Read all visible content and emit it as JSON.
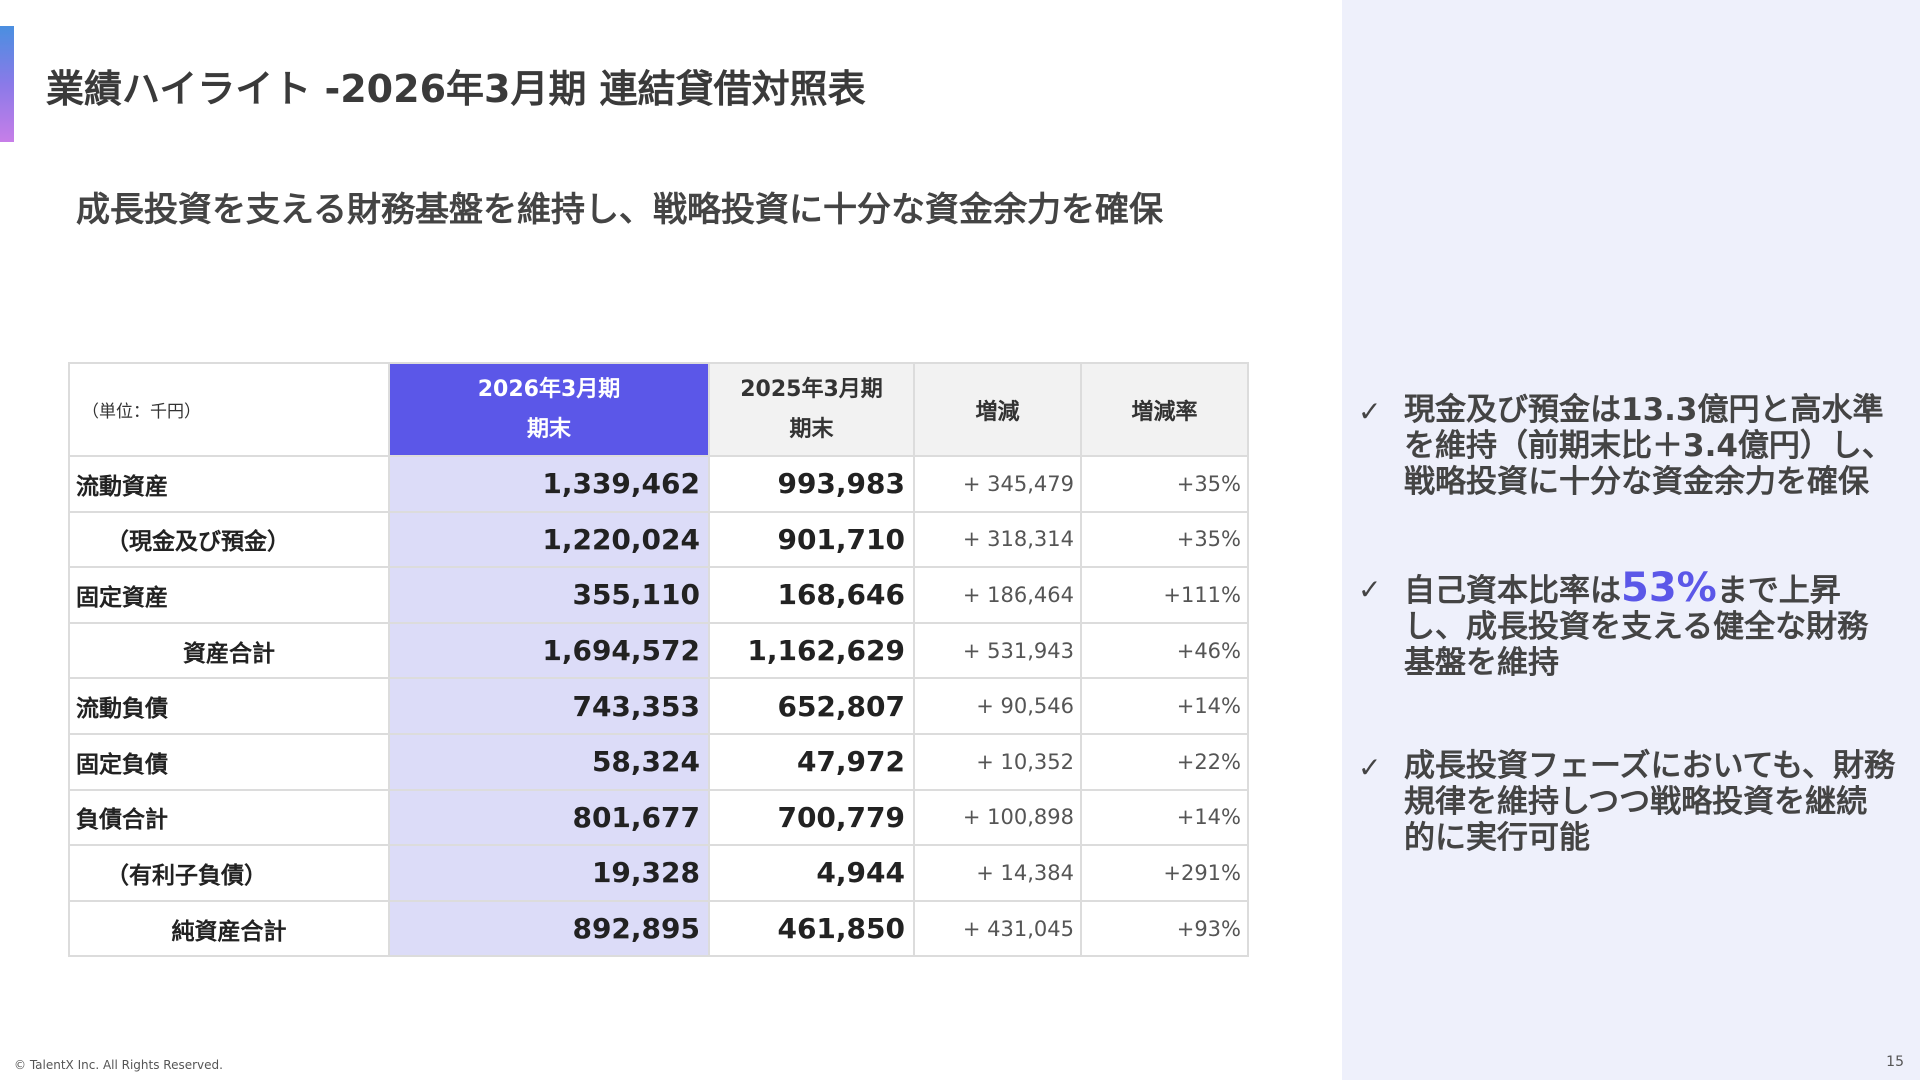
{
  "header": {
    "title": "業績ハイライト -2026年3月期 連結貸借対照表",
    "subtitle": "成長投資を支える財務基盤を維持し、戦略投資に十分な資金余力を確保"
  },
  "table": {
    "unit_label": "（単位：千円）",
    "columns": {
      "current_line1": "2026年3月期",
      "current_line2": "期末",
      "previous_line1": "2025年3月期",
      "previous_line2": "期末",
      "change": "増減",
      "change_rate": "増減率"
    },
    "rows": [
      {
        "label": "流動資産",
        "current": "1,339,462",
        "previous": "993,983",
        "change": "+ 345,479",
        "rate": "+35%"
      },
      {
        "label": "（現金及び預金）",
        "current": "1,220,024",
        "previous": "901,710",
        "change": "+ 318,314",
        "rate": "+35%"
      },
      {
        "label": "固定資産",
        "current": "355,110",
        "previous": "168,646",
        "change": "+ 186,464",
        "rate": "+111%"
      },
      {
        "label": "資産合計",
        "current": "1,694,572",
        "previous": "1,162,629",
        "change": "+ 531,943",
        "rate": "+46%"
      },
      {
        "label": "流動負債",
        "current": "743,353",
        "previous": "652,807",
        "change": "+ 90,546",
        "rate": "+14%"
      },
      {
        "label": "固定負債",
        "current": "58,324",
        "previous": "47,972",
        "change": "+ 10,352",
        "rate": "+22%"
      },
      {
        "label": "負債合計",
        "current": "801,677",
        "previous": "700,779",
        "change": "+ 100,898",
        "rate": "+14%"
      },
      {
        "label": "（有利子負債）",
        "current": "19,328",
        "previous": "4,944",
        "change": "+ 14,384",
        "rate": "+291%"
      },
      {
        "label": "純資産合計",
        "current": "892,895",
        "previous": "461,850",
        "change": "+ 431,045",
        "rate": "+93%"
      }
    ]
  },
  "bullets": {
    "b1_text": "現金及び預金は13.3億円と高水準を維持（前期末比＋3.4億円）し、戦略投資に十分な資金余力を確保",
    "b2_pre": "自己資本比率は",
    "b2_highlight": "53%",
    "b2_post": "まで上昇し、成長投資を支える健全な財務基盤を維持",
    "b3_text": "成長投資フェーズにおいても、財務規律を維持しつつ戦略投資を継続的に実行可能"
  },
  "footer": {
    "copyright": "© TalentX Inc. All Rights Reserved.",
    "page_number": "15"
  },
  "colors": {
    "accent": "#5b57e8",
    "current_cell_bg": "#dcdcf8",
    "right_panel_bg": "#eef0fb"
  }
}
